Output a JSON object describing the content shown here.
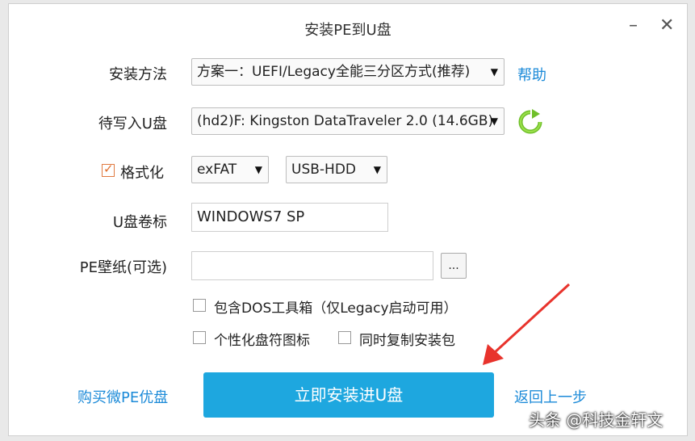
{
  "window": {
    "title": "安装PE到U盘",
    "minimize": "–",
    "close": "✕"
  },
  "install_method": {
    "label": "安装方法",
    "value": "方案一：UEFI/Legacy全能三分区方式(推荐)",
    "help": "帮助"
  },
  "target_disk": {
    "label": "待写入U盘",
    "value": "(hd2)F: Kingston DataTraveler 2.0 (14.6GB)",
    "refresh_icon": "refresh-icon"
  },
  "format": {
    "checked": true,
    "label": "格式化",
    "filesystem": "exFAT",
    "mode": "USB-HDD"
  },
  "volume_label": {
    "label": "U盘卷标",
    "value": "WINDOWS7 SP"
  },
  "wallpaper": {
    "label": "PE壁纸(可选)",
    "value": "",
    "browse": "..."
  },
  "options": {
    "dos_tools": {
      "label": "包含DOS工具箱（仅Legacy启动可用）",
      "checked": false
    },
    "personalize_icon": {
      "label": "个性化盘符图标",
      "checked": false
    },
    "copy_installer": {
      "label": "同时复制安装包",
      "checked": false
    }
  },
  "footer": {
    "buy": "购买微PE优盘",
    "install": "立即安装进U盘",
    "back": "返回上一步"
  },
  "watermark": "头条 @科技金轩文",
  "colors": {
    "accent": "#1ea7df",
    "link": "#1b8ad8",
    "annotation_arrow": "#e8332c",
    "refresh": "#6fbf2a"
  }
}
